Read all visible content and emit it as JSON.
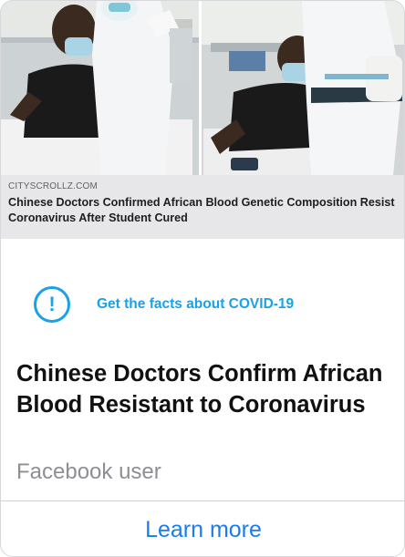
{
  "preview": {
    "domain": "CITYSCROLLZ.COM",
    "title": "Chinese Doctors Confirmed African Blood Genetic Composition Resist Coronavirus After Student Cured"
  },
  "facts": {
    "icon": "exclamation-icon",
    "icon_glyph": "!",
    "label": "Get the facts about COVID-19"
  },
  "post": {
    "headline": "Chinese Doctors Confirm African Blood Resistant to Coronavirus",
    "author": "Facebook user"
  },
  "action": {
    "learn_more_label": "Learn more"
  },
  "colors": {
    "accent": "#1aa1e8",
    "link": "#1a7cf0",
    "preview_bg": "#e7e7ea",
    "muted_text": "#8e8e93"
  }
}
